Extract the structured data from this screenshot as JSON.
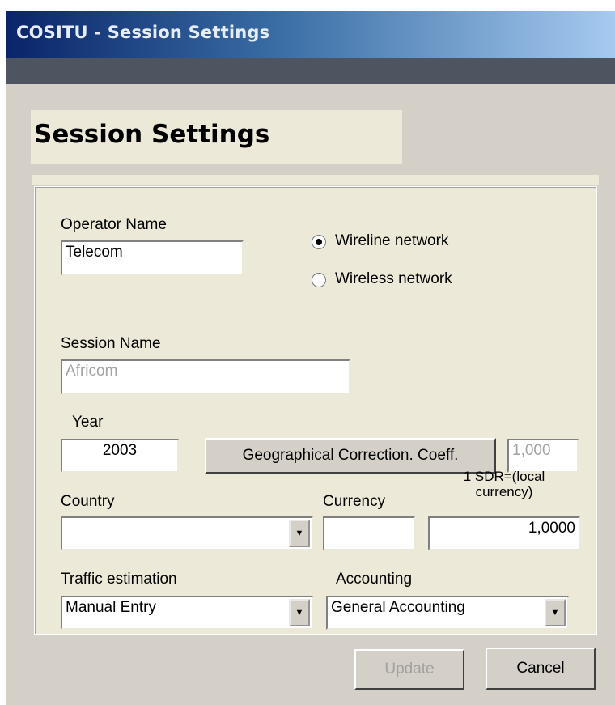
{
  "window": {
    "title": "COSITU - Session Settings"
  },
  "heading": "Session Settings",
  "operator": {
    "label": "Operator Name",
    "value": "Telecom"
  },
  "network": {
    "options": [
      {
        "label": "Wireline network",
        "selected": true
      },
      {
        "label": "Wireless network",
        "selected": false
      }
    ]
  },
  "session": {
    "label": "Session Name",
    "value": "Africom"
  },
  "year": {
    "label": "Year",
    "value": "2003"
  },
  "geo": {
    "button_label": "Geographical Correction. Coeff.",
    "value": "1,000"
  },
  "country": {
    "label": "Country",
    "value": ""
  },
  "currency": {
    "label": "Currency",
    "value": ""
  },
  "sdr": {
    "label_line1": "1 SDR=(local",
    "label_line2": "currency)",
    "value": "1,0000"
  },
  "traffic": {
    "label": "Traffic estimation",
    "value": "Manual Entry"
  },
  "accounting": {
    "label": "Accounting",
    "value": "General Accounting"
  },
  "buttons": {
    "update": "Update",
    "cancel": "Cancel"
  },
  "icons": {
    "dropdown": "chevron-down-icon"
  }
}
